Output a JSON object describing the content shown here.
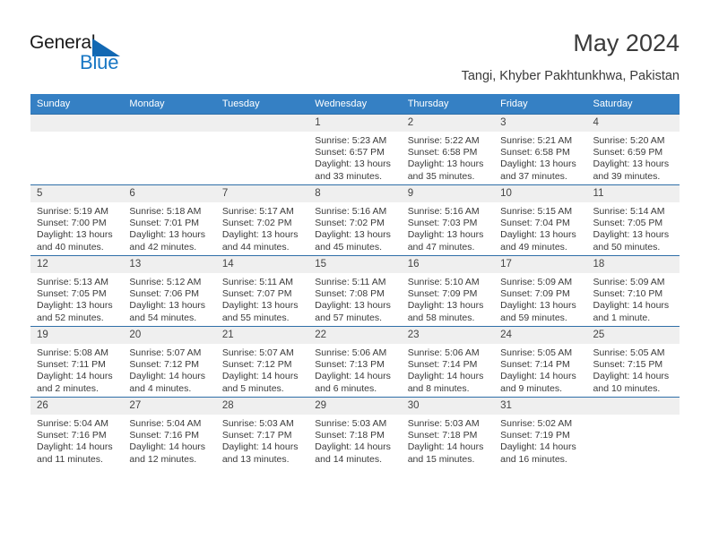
{
  "brand": {
    "name_dark": "General",
    "name_blue": "Blue",
    "accent_color": "#1877c4",
    "triangle_color": "#1268b3"
  },
  "header": {
    "title": "May 2024",
    "subtitle": "Tangi, Khyber Pakhtunkhwa, Pakistan",
    "header_bg_color": "#3580c4",
    "cell_band_color": "#efefef"
  },
  "calendar": {
    "weekdays": [
      "Sunday",
      "Monday",
      "Tuesday",
      "Wednesday",
      "Thursday",
      "Friday",
      "Saturday"
    ],
    "labels": {
      "sunrise": "Sunrise:",
      "sunset": "Sunset:",
      "daylight": "Daylight:"
    },
    "weeks": [
      [
        {
          "day": "",
          "empty": true
        },
        {
          "day": "",
          "empty": true
        },
        {
          "day": "",
          "empty": true
        },
        {
          "day": "1",
          "sunrise": "Sunrise: 5:23 AM",
          "sunset": "Sunset: 6:57 PM",
          "daylight1": "Daylight: 13 hours",
          "daylight2": "and 33 minutes."
        },
        {
          "day": "2",
          "sunrise": "Sunrise: 5:22 AM",
          "sunset": "Sunset: 6:58 PM",
          "daylight1": "Daylight: 13 hours",
          "daylight2": "and 35 minutes."
        },
        {
          "day": "3",
          "sunrise": "Sunrise: 5:21 AM",
          "sunset": "Sunset: 6:58 PM",
          "daylight1": "Daylight: 13 hours",
          "daylight2": "and 37 minutes."
        },
        {
          "day": "4",
          "sunrise": "Sunrise: 5:20 AM",
          "sunset": "Sunset: 6:59 PM",
          "daylight1": "Daylight: 13 hours",
          "daylight2": "and 39 minutes."
        }
      ],
      [
        {
          "day": "5",
          "sunrise": "Sunrise: 5:19 AM",
          "sunset": "Sunset: 7:00 PM",
          "daylight1": "Daylight: 13 hours",
          "daylight2": "and 40 minutes."
        },
        {
          "day": "6",
          "sunrise": "Sunrise: 5:18 AM",
          "sunset": "Sunset: 7:01 PM",
          "daylight1": "Daylight: 13 hours",
          "daylight2": "and 42 minutes."
        },
        {
          "day": "7",
          "sunrise": "Sunrise: 5:17 AM",
          "sunset": "Sunset: 7:02 PM",
          "daylight1": "Daylight: 13 hours",
          "daylight2": "and 44 minutes."
        },
        {
          "day": "8",
          "sunrise": "Sunrise: 5:16 AM",
          "sunset": "Sunset: 7:02 PM",
          "daylight1": "Daylight: 13 hours",
          "daylight2": "and 45 minutes."
        },
        {
          "day": "9",
          "sunrise": "Sunrise: 5:16 AM",
          "sunset": "Sunset: 7:03 PM",
          "daylight1": "Daylight: 13 hours",
          "daylight2": "and 47 minutes."
        },
        {
          "day": "10",
          "sunrise": "Sunrise: 5:15 AM",
          "sunset": "Sunset: 7:04 PM",
          "daylight1": "Daylight: 13 hours",
          "daylight2": "and 49 minutes."
        },
        {
          "day": "11",
          "sunrise": "Sunrise: 5:14 AM",
          "sunset": "Sunset: 7:05 PM",
          "daylight1": "Daylight: 13 hours",
          "daylight2": "and 50 minutes."
        }
      ],
      [
        {
          "day": "12",
          "sunrise": "Sunrise: 5:13 AM",
          "sunset": "Sunset: 7:05 PM",
          "daylight1": "Daylight: 13 hours",
          "daylight2": "and 52 minutes."
        },
        {
          "day": "13",
          "sunrise": "Sunrise: 5:12 AM",
          "sunset": "Sunset: 7:06 PM",
          "daylight1": "Daylight: 13 hours",
          "daylight2": "and 54 minutes."
        },
        {
          "day": "14",
          "sunrise": "Sunrise: 5:11 AM",
          "sunset": "Sunset: 7:07 PM",
          "daylight1": "Daylight: 13 hours",
          "daylight2": "and 55 minutes."
        },
        {
          "day": "15",
          "sunrise": "Sunrise: 5:11 AM",
          "sunset": "Sunset: 7:08 PM",
          "daylight1": "Daylight: 13 hours",
          "daylight2": "and 57 minutes."
        },
        {
          "day": "16",
          "sunrise": "Sunrise: 5:10 AM",
          "sunset": "Sunset: 7:09 PM",
          "daylight1": "Daylight: 13 hours",
          "daylight2": "and 58 minutes."
        },
        {
          "day": "17",
          "sunrise": "Sunrise: 5:09 AM",
          "sunset": "Sunset: 7:09 PM",
          "daylight1": "Daylight: 13 hours",
          "daylight2": "and 59 minutes."
        },
        {
          "day": "18",
          "sunrise": "Sunrise: 5:09 AM",
          "sunset": "Sunset: 7:10 PM",
          "daylight1": "Daylight: 14 hours",
          "daylight2": "and 1 minute."
        }
      ],
      [
        {
          "day": "19",
          "sunrise": "Sunrise: 5:08 AM",
          "sunset": "Sunset: 7:11 PM",
          "daylight1": "Daylight: 14 hours",
          "daylight2": "and 2 minutes."
        },
        {
          "day": "20",
          "sunrise": "Sunrise: 5:07 AM",
          "sunset": "Sunset: 7:12 PM",
          "daylight1": "Daylight: 14 hours",
          "daylight2": "and 4 minutes."
        },
        {
          "day": "21",
          "sunrise": "Sunrise: 5:07 AM",
          "sunset": "Sunset: 7:12 PM",
          "daylight1": "Daylight: 14 hours",
          "daylight2": "and 5 minutes."
        },
        {
          "day": "22",
          "sunrise": "Sunrise: 5:06 AM",
          "sunset": "Sunset: 7:13 PM",
          "daylight1": "Daylight: 14 hours",
          "daylight2": "and 6 minutes."
        },
        {
          "day": "23",
          "sunrise": "Sunrise: 5:06 AM",
          "sunset": "Sunset: 7:14 PM",
          "daylight1": "Daylight: 14 hours",
          "daylight2": "and 8 minutes."
        },
        {
          "day": "24",
          "sunrise": "Sunrise: 5:05 AM",
          "sunset": "Sunset: 7:14 PM",
          "daylight1": "Daylight: 14 hours",
          "daylight2": "and 9 minutes."
        },
        {
          "day": "25",
          "sunrise": "Sunrise: 5:05 AM",
          "sunset": "Sunset: 7:15 PM",
          "daylight1": "Daylight: 14 hours",
          "daylight2": "and 10 minutes."
        }
      ],
      [
        {
          "day": "26",
          "sunrise": "Sunrise: 5:04 AM",
          "sunset": "Sunset: 7:16 PM",
          "daylight1": "Daylight: 14 hours",
          "daylight2": "and 11 minutes."
        },
        {
          "day": "27",
          "sunrise": "Sunrise: 5:04 AM",
          "sunset": "Sunset: 7:16 PM",
          "daylight1": "Daylight: 14 hours",
          "daylight2": "and 12 minutes."
        },
        {
          "day": "28",
          "sunrise": "Sunrise: 5:03 AM",
          "sunset": "Sunset: 7:17 PM",
          "daylight1": "Daylight: 14 hours",
          "daylight2": "and 13 minutes."
        },
        {
          "day": "29",
          "sunrise": "Sunrise: 5:03 AM",
          "sunset": "Sunset: 7:18 PM",
          "daylight1": "Daylight: 14 hours",
          "daylight2": "and 14 minutes."
        },
        {
          "day": "30",
          "sunrise": "Sunrise: 5:03 AM",
          "sunset": "Sunset: 7:18 PM",
          "daylight1": "Daylight: 14 hours",
          "daylight2": "and 15 minutes."
        },
        {
          "day": "31",
          "sunrise": "Sunrise: 5:02 AM",
          "sunset": "Sunset: 7:19 PM",
          "daylight1": "Daylight: 14 hours",
          "daylight2": "and 16 minutes."
        },
        {
          "day": "",
          "empty": true
        }
      ]
    ]
  }
}
